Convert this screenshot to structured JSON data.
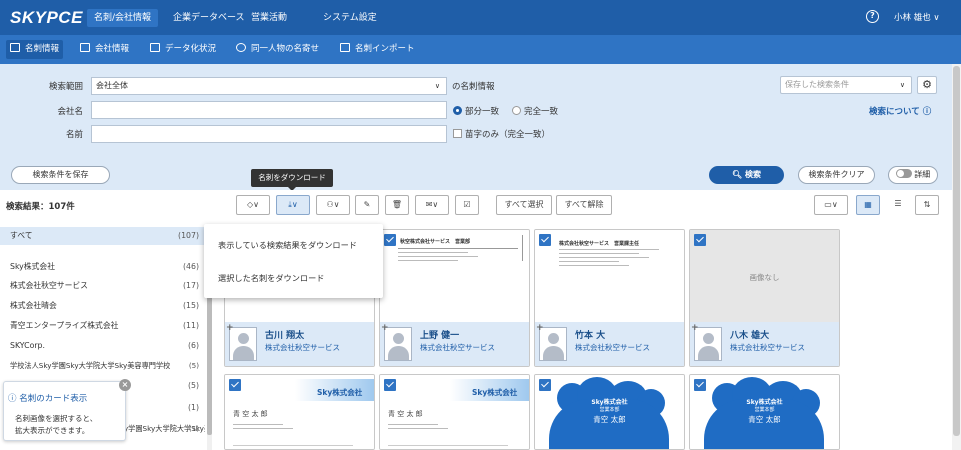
{
  "app": {
    "logo": "SKYPCE",
    "user": "小林 雄也 ∨"
  },
  "topnav": [
    "名刺/会社情報",
    "企業データベース",
    "営業活動",
    "システム設定"
  ],
  "subnav": [
    "名刺情報",
    "会社情報",
    "データ化状況",
    "同一人物の名寄せ",
    "名刺インポート"
  ],
  "search": {
    "range_label": "検索範囲",
    "range_value": "会社全体",
    "range_suffix": "の名刺情報",
    "company_label": "会社名",
    "name_label": "名前",
    "match_partial": "部分一致",
    "match_exact": "完全一致",
    "surname_only": "苗字のみ（完全一致）",
    "saved_placeholder": "保存した検索条件",
    "about_link": "検索について ⓘ",
    "save_condition": "検索条件を保存",
    "search_button": "検索",
    "clear_button": "検索条件クリア",
    "detail_toggle": "詳細"
  },
  "tooltip": "名刺をダウンロード",
  "result_count": "検索結果：107件",
  "toolbar": {
    "select_all": "すべて選択",
    "deselect_all": "すべて解除"
  },
  "dropdown": [
    "表示している検索結果をダウンロード",
    "選択した名刺をダウンロード"
  ],
  "sidebar": [
    {
      "label": "すべて",
      "count": "(107)"
    },
    {
      "label": "Sky株式会社",
      "count": "(46)"
    },
    {
      "label": "株式会社秋空サービス",
      "count": "(17)"
    },
    {
      "label": "株式会社晴会",
      "count": "(15)"
    },
    {
      "label": "青空エンタープライズ株式会社",
      "count": "(11)"
    },
    {
      "label": "SKYCorp.",
      "count": "(6)"
    },
    {
      "label": "学校法人Sky学園Sky大学院大学Sky美容専門学校",
      "count": "(5)"
    },
    {
      "label": "",
      "count": "(5)"
    },
    {
      "label": "",
      "count": "(1)"
    },
    {
      "label": "ky学園Sky大学院大学Sky美容専門学校",
      "count": "(1)"
    }
  ],
  "info_popup": {
    "title": "名刺のカード表示",
    "text1": "名刺画像を選択すると、",
    "text2": "拡大表示ができます。"
  },
  "cards": [
    {
      "name": "古川 翔太",
      "company": "株式会社秋空サービス"
    },
    {
      "name": "上野 健一",
      "company": "株式会社秋空サービス"
    },
    {
      "name": "竹本 大",
      "company": "株式会社秋空サービス"
    },
    {
      "name": "八木 雄大",
      "company": "株式会社秋空サービス",
      "no_image": "画像なし"
    }
  ],
  "card_images": {
    "c2_top": "秋空株式会社サービス　営業部",
    "c3_top": "株式会社秋空サービス　営業課主任",
    "sky_company": "Sky株式会社",
    "person_name": "青 空 太 郎",
    "cloud_company": "Sky株式会社",
    "cloud_dept": "営業本部",
    "cloud_name": "青空 太郎"
  }
}
